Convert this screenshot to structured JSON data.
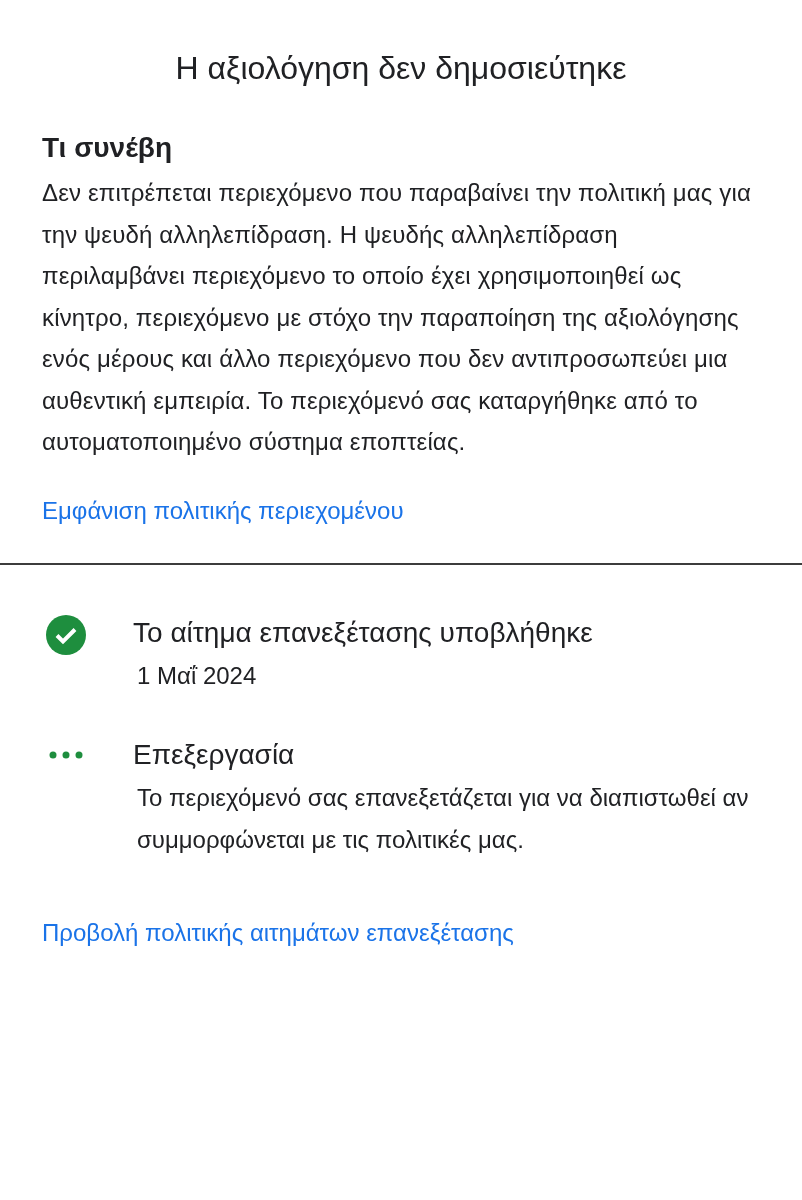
{
  "title": "Η αξιολόγηση δεν δημοσιεύτηκε",
  "what_happened": {
    "heading": "Τι συνέβη",
    "body": "Δεν επιτρέπεται περιεχόμενο που παραβαίνει την πολιτική μας για την ψευδή αλληλεπίδραση. Η ψευδής αλληλεπίδραση περιλαμβάνει περιεχόμενο το οποίο έχει χρησιμοποιηθεί ως κίνητρο, περιεχόμενο με στόχο την παραποίηση της αξιολόγησης ενός μέρους και άλλο περιεχόμενο που δεν αντιπροσωπεύει μια αυθεντική εμπειρία. Το περιεχόμενό σας καταργήθηκε από το αυτοματοποιημένο σύστημα εποπτείας.",
    "link": "Εμφάνιση πολιτικής περιεχομένου"
  },
  "timeline": [
    {
      "kind": "done",
      "title": "Το αίτημα επανεξέτασης υποβλήθηκε",
      "detail": "1 Μαΐ 2024"
    },
    {
      "kind": "in_progress",
      "title": "Επεξεργασία",
      "detail": "Το περιεχόμενό σας επανεξετάζεται για να διαπιστωθεί αν συμμορφώνεται με τις πολιτικές μας."
    }
  ],
  "footer_link": "Προβολή πολιτικής αιτημάτων επανεξέτασης"
}
